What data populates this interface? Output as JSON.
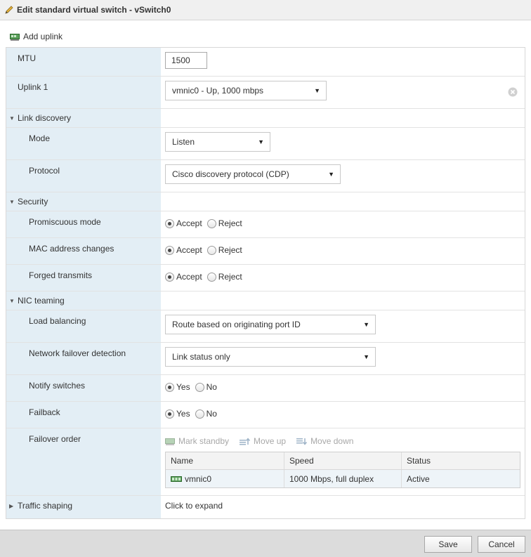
{
  "dialog": {
    "title": "Edit standard virtual switch - vSwitch0"
  },
  "toolbar": {
    "add_uplink": "Add uplink"
  },
  "mtu": {
    "label": "MTU",
    "value": "1500"
  },
  "uplink1": {
    "label": "Uplink 1",
    "value": "vmnic0 - Up, 1000 mbps"
  },
  "link_discovery": {
    "label": "Link discovery",
    "mode": {
      "label": "Mode",
      "value": "Listen"
    },
    "protocol": {
      "label": "Protocol",
      "value": "Cisco discovery protocol (CDP)"
    }
  },
  "security": {
    "label": "Security",
    "promiscuous": {
      "label": "Promiscuous mode",
      "selected": "Accept"
    },
    "mac_changes": {
      "label": "MAC address changes",
      "selected": "Accept"
    },
    "forged": {
      "label": "Forged transmits",
      "selected": "Accept"
    },
    "options": {
      "accept": "Accept",
      "reject": "Reject"
    }
  },
  "nic_teaming": {
    "label": "NIC teaming",
    "load_balancing": {
      "label": "Load balancing",
      "value": "Route based on originating port ID"
    },
    "failover_detection": {
      "label": "Network failover detection",
      "value": "Link status only"
    },
    "notify_switches": {
      "label": "Notify switches",
      "selected": "Yes"
    },
    "failback": {
      "label": "Failback",
      "selected": "Yes"
    },
    "options": {
      "yes": "Yes",
      "no": "No"
    },
    "failover_order": {
      "label": "Failover order",
      "mark_standby": "Mark standby",
      "move_up": "Move up",
      "move_down": "Move down",
      "columns": [
        "Name",
        "Speed",
        "Status"
      ],
      "rows": [
        {
          "name": "vmnic0",
          "speed": "1000 Mbps, full duplex",
          "status": "Active"
        }
      ]
    }
  },
  "traffic_shaping": {
    "label": "Traffic shaping",
    "value": "Click to expand"
  },
  "buttons": {
    "save": "Save",
    "cancel": "Cancel"
  },
  "colors": {
    "label_bg": "#e3eef5",
    "footer_bg": "#dcdcdc",
    "nic_icon": "#3a8a3a"
  }
}
